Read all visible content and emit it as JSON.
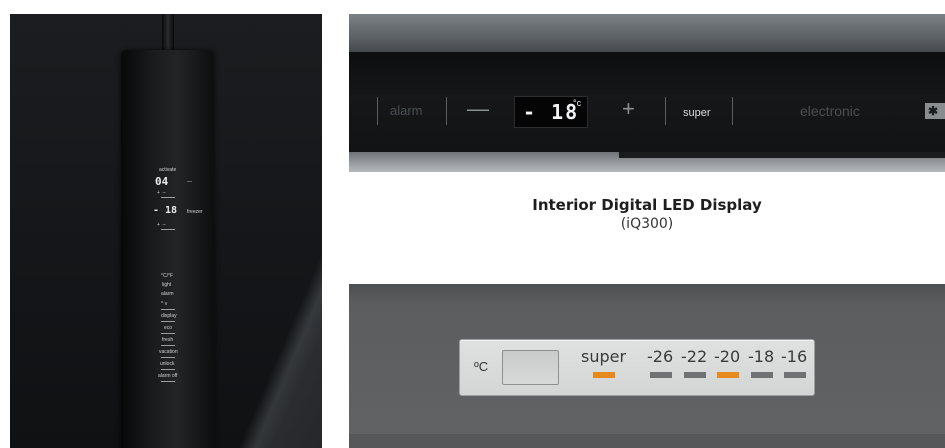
{
  "left_strip": {
    "controls_upper": [
      "activate"
    ],
    "display_upper": "04",
    "upper_side_labels": [
      "—",
      "—"
    ],
    "display_lower": "- 18",
    "lower_side_label": "freezer",
    "controls_lower": [
      "°C/°F",
      "light",
      "alarm",
      "^ v",
      "display",
      "eco",
      "fresh",
      "vacation",
      "unlock",
      "alarm off"
    ]
  },
  "led_display": {
    "alarm_label": "alarm",
    "minus_label": "—",
    "temperature": "- 18",
    "unit": "°c",
    "plus_label": "+",
    "super_label": "super",
    "electronic_label": "electronic",
    "badge": "✱"
  },
  "caption": {
    "title": "Interior Digital LED Display",
    "subtitle": "(iQ300)"
  },
  "control_plate": {
    "unit_label": "ºC",
    "super_label": "super",
    "temperatures": [
      "-26",
      "-22",
      "-20",
      "-18",
      "-16"
    ],
    "super_on": true,
    "active_temperature": "-20",
    "indicator_on_color": "#e68a1e",
    "indicator_off_color": "#6f7173"
  }
}
